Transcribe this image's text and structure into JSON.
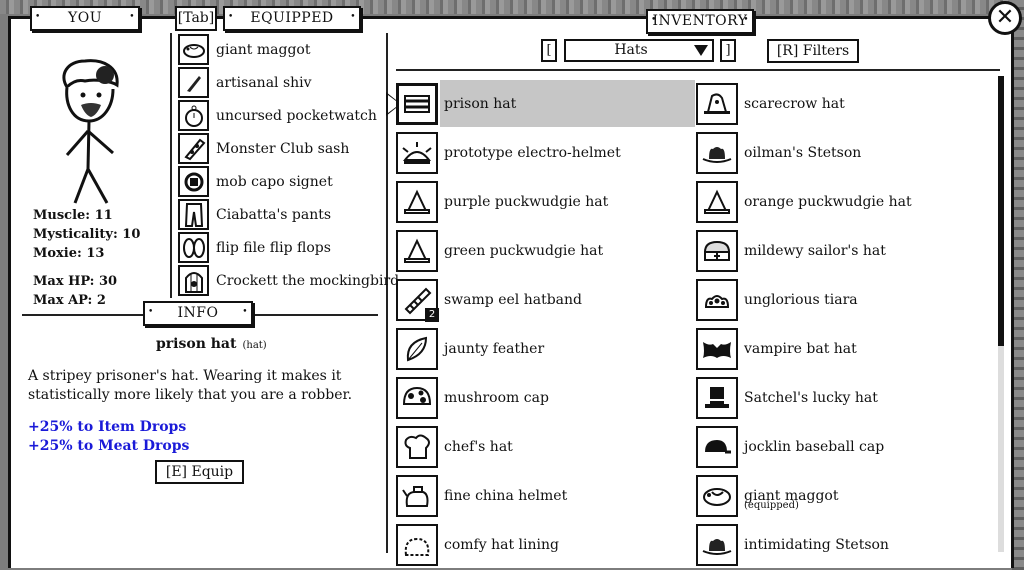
{
  "tabs": {
    "you": "YOU",
    "tab_key": "[Tab]",
    "equipped": "EQUIPPED",
    "inventory": "INVENTORY",
    "info": "INFO"
  },
  "close_label": "✕",
  "stats": {
    "muscle": "Muscle: 11",
    "mysticality": "Mysticality: 10",
    "moxie": "Moxie: 13",
    "max_hp": "Max HP: 30",
    "max_ap": "Max AP: 2"
  },
  "equipped": [
    {
      "label": "giant maggot",
      "icon": "maggot-icon"
    },
    {
      "label": "artisanal shiv",
      "icon": "shiv-icon"
    },
    {
      "label": "uncursed pocketwatch",
      "icon": "pocketwatch-icon"
    },
    {
      "label": "Monster Club sash",
      "icon": "sash-icon"
    },
    {
      "label": "mob capo signet",
      "icon": "signet-icon"
    },
    {
      "label": "Ciabatta's pants",
      "icon": "pants-icon"
    },
    {
      "label": "flip file flip flops",
      "icon": "flipflops-icon"
    },
    {
      "label": "Crockett the mockingbird",
      "icon": "birdcage-icon"
    }
  ],
  "info": {
    "item_name": "prison hat",
    "item_type": "(hat)",
    "description": "A stripey prisoner's hat.  Wearing it makes it statistically more likely that you are a robber.",
    "bonus_1": "+25% to Item Drops",
    "bonus_2": "+25% to Meat Drops",
    "equip_button": "[E]  Equip"
  },
  "inventory": {
    "prev_key": "[",
    "next_key": "]",
    "category": "Hats",
    "filters_button": "[R]  Filters",
    "left_column": [
      {
        "label": "prison hat",
        "icon": "prison-hat-icon",
        "selected": true
      },
      {
        "label": "prototype electro-helmet",
        "icon": "electro-helmet-icon"
      },
      {
        "label": "purple puckwudgie hat",
        "icon": "puckwudgie-hat-icon"
      },
      {
        "label": "green puckwudgie hat",
        "icon": "puckwudgie-hat-icon"
      },
      {
        "label": "swamp eel hatband",
        "icon": "hatband-icon",
        "count": "2"
      },
      {
        "label": "jaunty feather",
        "icon": "feather-icon"
      },
      {
        "label": "mushroom cap",
        "icon": "mushroom-icon"
      },
      {
        "label": "chef's hat",
        "icon": "chef-hat-icon"
      },
      {
        "label": "fine china helmet",
        "icon": "teapot-icon"
      },
      {
        "label": "comfy hat lining",
        "icon": "hat-lining-icon"
      }
    ],
    "right_column": [
      {
        "label": "scarecrow hat",
        "icon": "scarecrow-hat-icon"
      },
      {
        "label": "oilman's Stetson",
        "icon": "stetson-icon"
      },
      {
        "label": "orange puckwudgie hat",
        "icon": "puckwudgie-hat-icon"
      },
      {
        "label": "mildewy sailor's hat",
        "icon": "sailor-hat-icon"
      },
      {
        "label": "unglorious tiara",
        "icon": "tiara-icon"
      },
      {
        "label": "vampire bat hat",
        "icon": "bat-hat-icon"
      },
      {
        "label": "Satchel's lucky hat",
        "icon": "top-hat-icon"
      },
      {
        "label": "jocklin baseball cap",
        "icon": "baseball-cap-icon"
      },
      {
        "label": "giant maggot",
        "icon": "maggot-icon",
        "sub": "(equipped)"
      },
      {
        "label": "intimidating Stetson",
        "icon": "stetson-icon"
      }
    ]
  }
}
